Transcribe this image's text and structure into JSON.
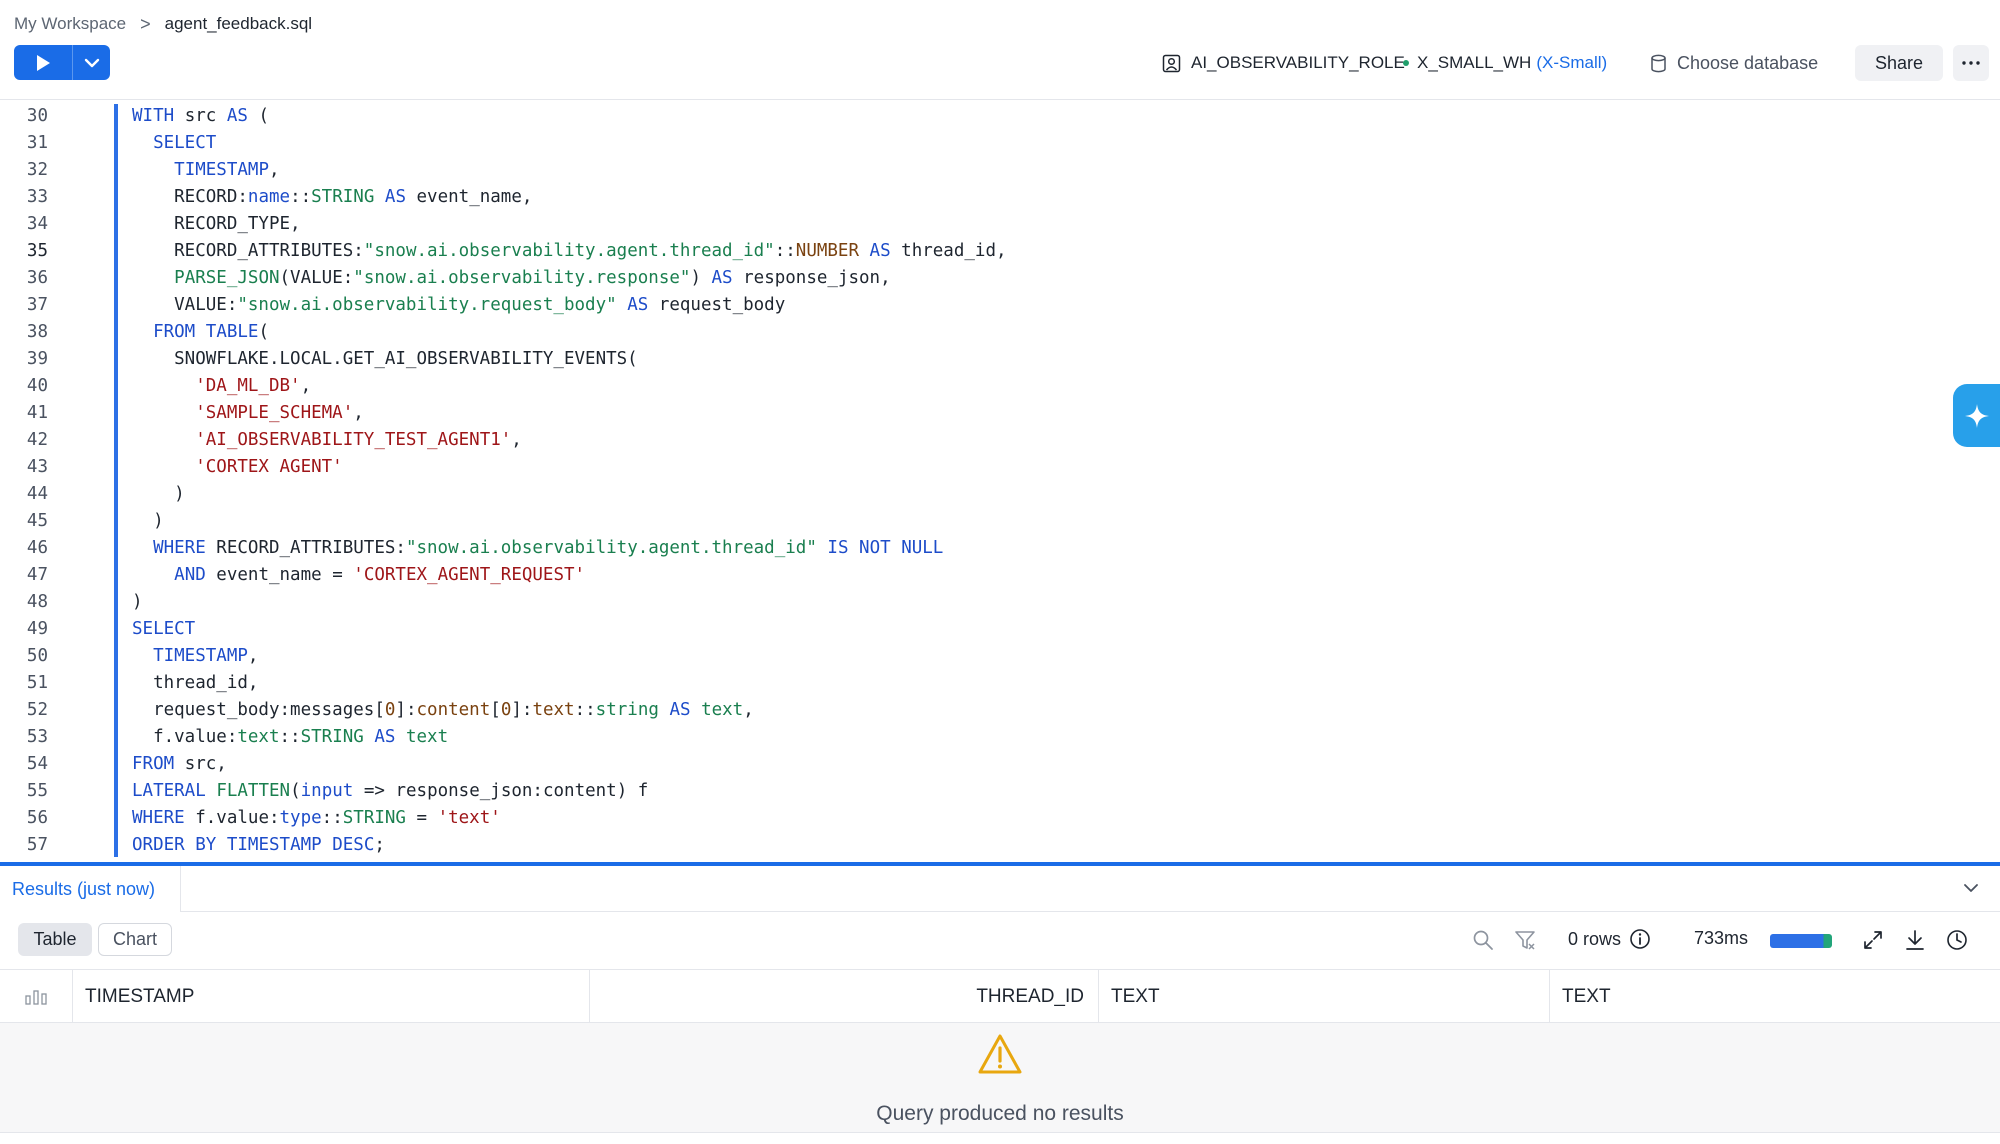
{
  "breadcrumb": {
    "workspace": "My Workspace",
    "separator": ">",
    "file": "agent_feedback.sql"
  },
  "toolbar": {
    "role": "AI_OBSERVABILITY_ROLE",
    "warehouse": "X_SMALL_WH",
    "warehouse_size": "(X-Small)",
    "database_placeholder": "Choose database",
    "share_label": "Share",
    "more_label": "⋯"
  },
  "colors": {
    "accent": "#1a6ce7",
    "keyword": "#1d4cc9",
    "identifier_string": "#1a7f4f",
    "string_literal": "#9e1518",
    "type": "#7a4210",
    "warning": "#e8a70f",
    "status_ok": "#1f9e6a"
  },
  "editor": {
    "active_line": "35",
    "lines": [
      {
        "n": "30",
        "html": "<span class=\"k\">WITH</span> src <span class=\"k\">AS</span> ("
      },
      {
        "n": "31",
        "html": "  <span class=\"k\">SELECT</span>"
      },
      {
        "n": "32",
        "html": "    <span class=\"k\">TIMESTAMP</span>,"
      },
      {
        "n": "33",
        "html": "    RECORD:<span class=\"k\">name</span>::<span class=\"s\">STRING</span> <span class=\"k\">AS</span> event_name,"
      },
      {
        "n": "34",
        "html": "    RECORD_TYPE,"
      },
      {
        "n": "35",
        "html": "    RECORD_ATTRIBUTES:<span class=\"s\">\"snow.ai.observability.agent.thread_id\"</span>::<span class=\"t\">NUMBER</span> <span class=\"k\">AS</span> thread_id,"
      },
      {
        "n": "36",
        "html": "    <span class=\"s\">PARSE_JSON</span>(VALUE:<span class=\"s\">\"snow.ai.observability.response\"</span>) <span class=\"k\">AS</span> response_json,"
      },
      {
        "n": "37",
        "html": "    VALUE:<span class=\"s\">\"snow.ai.observability.request_body\"</span> <span class=\"k\">AS</span> request_body"
      },
      {
        "n": "38",
        "html": "  <span class=\"k\">FROM</span> <span class=\"k\">TABLE</span>("
      },
      {
        "n": "39",
        "html": "    SNOWFLAKE.LOCAL.GET_AI_OBSERVABILITY_EVENTS("
      },
      {
        "n": "40",
        "html": "      <span class=\"q\">'DA_ML_DB'</span>,"
      },
      {
        "n": "41",
        "html": "      <span class=\"q\">'SAMPLE_SCHEMA'</span>,"
      },
      {
        "n": "42",
        "html": "      <span class=\"q\">'AI_OBSERVABILITY_TEST_AGENT1'</span>,"
      },
      {
        "n": "43",
        "html": "      <span class=\"q\">'CORTEX AGENT'</span>"
      },
      {
        "n": "44",
        "html": "    )"
      },
      {
        "n": "45",
        "html": "  )"
      },
      {
        "n": "46",
        "html": "  <span class=\"k\">WHERE</span> RECORD_ATTRIBUTES:<span class=\"s\">\"snow.ai.observability.agent.thread_id\"</span> <span class=\"k\">IS</span> <span class=\"k\">NOT</span> <span class=\"k\">NULL</span>"
      },
      {
        "n": "47",
        "html": "    <span class=\"k\">AND</span> event_name = <span class=\"q\">'CORTEX_AGENT_REQUEST'</span>"
      },
      {
        "n": "48",
        "html": ")"
      },
      {
        "n": "49",
        "html": "<span class=\"k\">SELECT</span>"
      },
      {
        "n": "50",
        "html": "  <span class=\"k\">TIMESTAMP</span>,"
      },
      {
        "n": "51",
        "html": "  thread_id,"
      },
      {
        "n": "52",
        "html": "  request_body:messages[<span class=\"t\">0</span>]:<span class=\"t\">content</span>[<span class=\"t\">0</span>]:<span class=\"t\">text</span>::<span class=\"s\">string</span> <span class=\"k\">AS</span> <span class=\"s\">text</span>,"
      },
      {
        "n": "53",
        "html": "  f.value:<span class=\"s\">text</span>::<span class=\"s\">STRING</span> <span class=\"k\">AS</span> <span class=\"s\">text</span>"
      },
      {
        "n": "54",
        "html": "<span class=\"k\">FROM</span> src,"
      },
      {
        "n": "55",
        "html": "<span class=\"k\">LATERAL</span> <span class=\"s\">FLATTEN</span>(<span class=\"k\">input</span> =&gt; response_json:content) f"
      },
      {
        "n": "56",
        "html": "<span class=\"k\">WHERE</span> f.value:<span class=\"k\">type</span>::<span class=\"s\">STRING</span> = <span class=\"q\">'text'</span>"
      },
      {
        "n": "57",
        "html": "<span class=\"k\">ORDER</span> <span class=\"k\">BY</span> <span class=\"k\">TIMESTAMP</span> <span class=\"k\">DESC</span>;"
      }
    ]
  },
  "results": {
    "tab_label": "Results (just now)",
    "view_table": "Table",
    "view_chart": "Chart",
    "row_count": "0 rows",
    "duration": "733ms",
    "progress": 1.0,
    "columns": [
      "TIMESTAMP",
      "THREAD_ID",
      "TEXT",
      "TEXT"
    ],
    "empty_message": "Query produced no results"
  },
  "icons": [
    "play-icon",
    "chevron-down-icon",
    "role-icon",
    "database-icon",
    "more-icon",
    "sparkle-icon",
    "collapse-chevron-icon",
    "search-icon",
    "filter-icon",
    "info-icon",
    "expand-icon",
    "download-icon",
    "history-icon",
    "column-stats-icon",
    "warning-icon"
  ]
}
